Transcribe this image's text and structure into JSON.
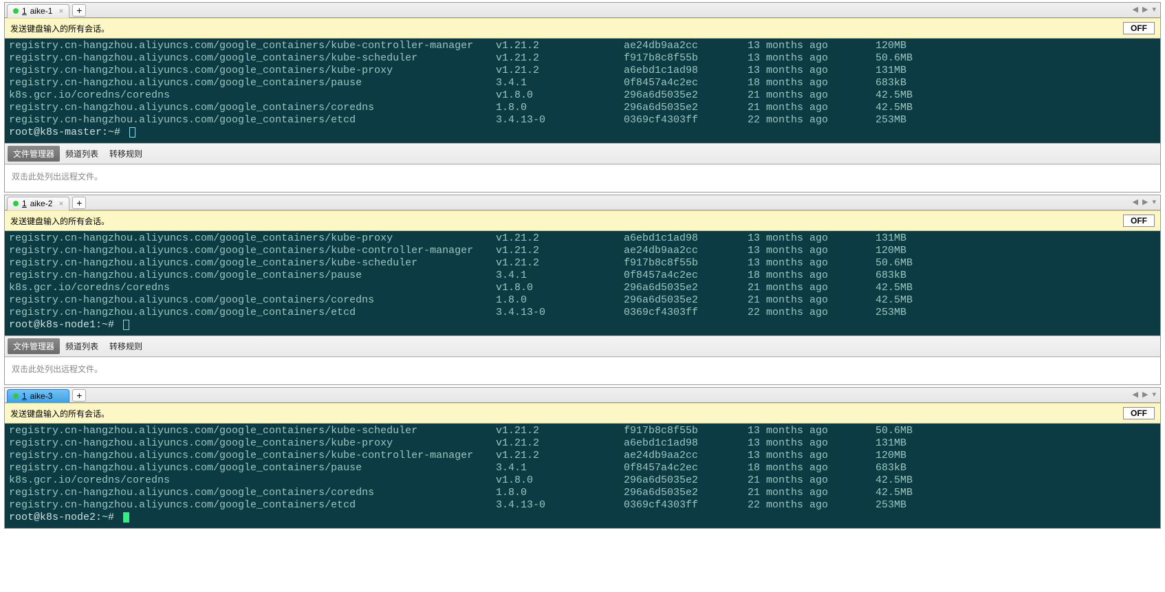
{
  "panes": [
    {
      "tab_number": "1",
      "tab_label": "aike-1",
      "tab_active_blue": false,
      "banner_text": "发送键盘输入的所有会话。",
      "off_label": "OFF",
      "rows": [
        {
          "repo": "registry.cn-hangzhou.aliyuncs.com/google_containers/kube-controller-manager",
          "tag": "v1.21.2",
          "id": "ae24db9aa2cc",
          "age": "13 months ago",
          "size": "120MB"
        },
        {
          "repo": "registry.cn-hangzhou.aliyuncs.com/google_containers/kube-scheduler",
          "tag": "v1.21.2",
          "id": "f917b8c8f55b",
          "age": "13 months ago",
          "size": "50.6MB"
        },
        {
          "repo": "registry.cn-hangzhou.aliyuncs.com/google_containers/kube-proxy",
          "tag": "v1.21.2",
          "id": "a6ebd1c1ad98",
          "age": "13 months ago",
          "size": "131MB"
        },
        {
          "repo": "registry.cn-hangzhou.aliyuncs.com/google_containers/pause",
          "tag": "3.4.1",
          "id": "0f8457a4c2ec",
          "age": "18 months ago",
          "size": "683kB"
        },
        {
          "repo": "k8s.gcr.io/coredns/coredns",
          "tag": "v1.8.0",
          "id": "296a6d5035e2",
          "age": "21 months ago",
          "size": "42.5MB"
        },
        {
          "repo": "registry.cn-hangzhou.aliyuncs.com/google_containers/coredns",
          "tag": "1.8.0",
          "id": "296a6d5035e2",
          "age": "21 months ago",
          "size": "42.5MB"
        },
        {
          "repo": "registry.cn-hangzhou.aliyuncs.com/google_containers/etcd",
          "tag": "3.4.13-0",
          "id": "0369cf4303ff",
          "age": "22 months ago",
          "size": "253MB"
        }
      ],
      "prompt": "root@k8s-master:~# ",
      "cursor": "line",
      "show_footer": true,
      "subtabs": {
        "active": "文件管理器",
        "items": [
          "文件管理器",
          "频道列表",
          "转移规则"
        ]
      },
      "filepanel_text": "双击此处列出远程文件。"
    },
    {
      "tab_number": "1",
      "tab_label": "aike-2",
      "tab_active_blue": false,
      "banner_text": "发送键盘输入的所有会话。",
      "off_label": "OFF",
      "rows": [
        {
          "repo": "registry.cn-hangzhou.aliyuncs.com/google_containers/kube-proxy",
          "tag": "v1.21.2",
          "id": "a6ebd1c1ad98",
          "age": "13 months ago",
          "size": "131MB"
        },
        {
          "repo": "registry.cn-hangzhou.aliyuncs.com/google_containers/kube-controller-manager",
          "tag": "v1.21.2",
          "id": "ae24db9aa2cc",
          "age": "13 months ago",
          "size": "120MB"
        },
        {
          "repo": "registry.cn-hangzhou.aliyuncs.com/google_containers/kube-scheduler",
          "tag": "v1.21.2",
          "id": "f917b8c8f55b",
          "age": "13 months ago",
          "size": "50.6MB"
        },
        {
          "repo": "registry.cn-hangzhou.aliyuncs.com/google_containers/pause",
          "tag": "3.4.1",
          "id": "0f8457a4c2ec",
          "age": "18 months ago",
          "size": "683kB"
        },
        {
          "repo": "k8s.gcr.io/coredns/coredns",
          "tag": "v1.8.0",
          "id": "296a6d5035e2",
          "age": "21 months ago",
          "size": "42.5MB"
        },
        {
          "repo": "registry.cn-hangzhou.aliyuncs.com/google_containers/coredns",
          "tag": "1.8.0",
          "id": "296a6d5035e2",
          "age": "21 months ago",
          "size": "42.5MB"
        },
        {
          "repo": "registry.cn-hangzhou.aliyuncs.com/google_containers/etcd",
          "tag": "3.4.13-0",
          "id": "0369cf4303ff",
          "age": "22 months ago",
          "size": "253MB"
        }
      ],
      "prompt": "root@k8s-node1:~# ",
      "cursor": "line",
      "show_footer": true,
      "subtabs": {
        "active": "文件管理器",
        "items": [
          "文件管理器",
          "频道列表",
          "转移规则"
        ]
      },
      "filepanel_text": "双击此处列出远程文件。"
    },
    {
      "tab_number": "1",
      "tab_label": "aike-3",
      "tab_active_blue": true,
      "banner_text": "发送键盘输入的所有会话。",
      "off_label": "OFF",
      "rows": [
        {
          "repo": "registry.cn-hangzhou.aliyuncs.com/google_containers/kube-scheduler",
          "tag": "v1.21.2",
          "id": "f917b8c8f55b",
          "age": "13 months ago",
          "size": "50.6MB"
        },
        {
          "repo": "registry.cn-hangzhou.aliyuncs.com/google_containers/kube-proxy",
          "tag": "v1.21.2",
          "id": "a6ebd1c1ad98",
          "age": "13 months ago",
          "size": "131MB"
        },
        {
          "repo": "registry.cn-hangzhou.aliyuncs.com/google_containers/kube-controller-manager",
          "tag": "v1.21.2",
          "id": "ae24db9aa2cc",
          "age": "13 months ago",
          "size": "120MB"
        },
        {
          "repo": "registry.cn-hangzhou.aliyuncs.com/google_containers/pause",
          "tag": "3.4.1",
          "id": "0f8457a4c2ec",
          "age": "18 months ago",
          "size": "683kB"
        },
        {
          "repo": "k8s.gcr.io/coredns/coredns",
          "tag": "v1.8.0",
          "id": "296a6d5035e2",
          "age": "21 months ago",
          "size": "42.5MB"
        },
        {
          "repo": "registry.cn-hangzhou.aliyuncs.com/google_containers/coredns",
          "tag": "1.8.0",
          "id": "296a6d5035e2",
          "age": "21 months ago",
          "size": "42.5MB"
        },
        {
          "repo": "registry.cn-hangzhou.aliyuncs.com/google_containers/etcd",
          "tag": "3.4.13-0",
          "id": "0369cf4303ff",
          "age": "22 months ago",
          "size": "253MB"
        }
      ],
      "prompt": "root@k8s-node2:~# ",
      "cursor": "block",
      "show_footer": false
    }
  ],
  "add_tab_label": "+",
  "nav_arrows": {
    "left": "◀",
    "right": "▶",
    "menu": "▾"
  }
}
